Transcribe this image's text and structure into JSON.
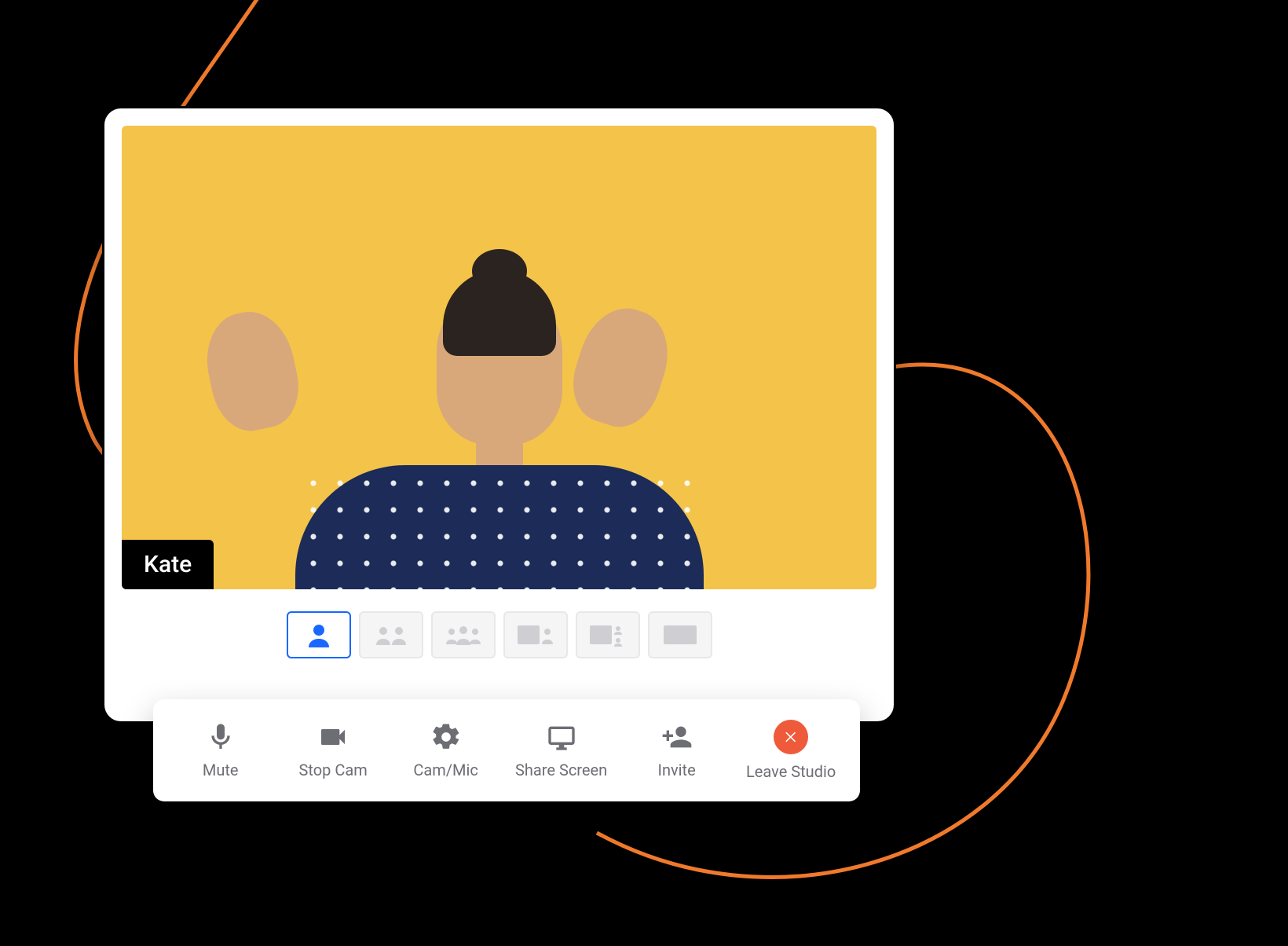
{
  "colors": {
    "video_bg": "#f4c34a",
    "accent": "#1868ff",
    "leave_bg": "#ee5a3a",
    "swoosh": "#f07a2b"
  },
  "participant": {
    "name": "Kate"
  },
  "layouts": {
    "items": [
      {
        "id": "solo",
        "selected": true
      },
      {
        "id": "two-up",
        "selected": false
      },
      {
        "id": "three-up",
        "selected": false
      },
      {
        "id": "content-one",
        "selected": false
      },
      {
        "id": "content-two",
        "selected": false
      },
      {
        "id": "content-full",
        "selected": false
      }
    ]
  },
  "toolbar": {
    "mute": {
      "label": "Mute",
      "icon": "mic-icon"
    },
    "stop_cam": {
      "label": "Stop Cam",
      "icon": "camera-icon"
    },
    "cam_mic": {
      "label": "Cam/Mic",
      "icon": "gear-icon"
    },
    "share_screen": {
      "label": "Share Screen",
      "icon": "screen-icon"
    },
    "invite": {
      "label": "Invite",
      "icon": "add-person-icon"
    },
    "leave": {
      "label": "Leave Studio",
      "icon": "close-icon"
    }
  }
}
